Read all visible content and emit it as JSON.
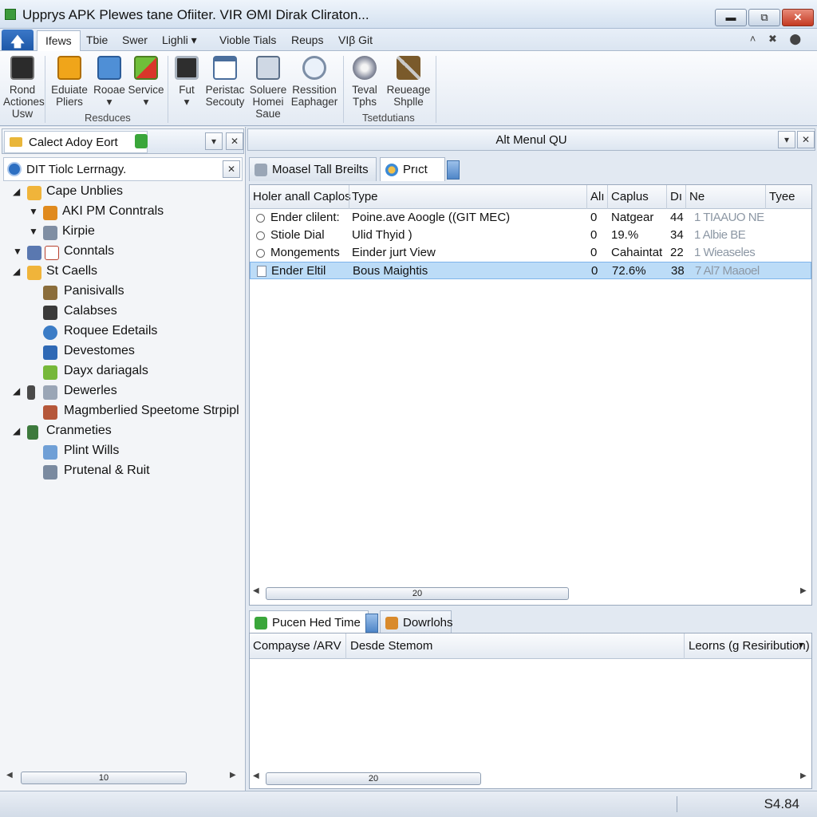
{
  "window": {
    "title": "Upprys APK Plewes tane Ofiiter. VIR ΘMI Dirak Cliraton...",
    "minimize_glyph": "▬",
    "restore_glyph": "⧉",
    "close_glyph": "✕"
  },
  "ribbon_tabs": {
    "file_glyph": "🡅",
    "items": [
      "Ifews",
      "Tbie",
      "Swer",
      "Lighli ▾",
      "Vioble Tials",
      "Reups",
      "VIβ Git"
    ],
    "right_glyphs": "˄ ✖ ⬤"
  },
  "ribbon": {
    "buttons": [
      {
        "line1": "Rond",
        "line2": "Actiones",
        "line3": "Usw",
        "icon": "record-icon"
      },
      {
        "line1": "Eduiate",
        "line2": "Pliers",
        "icon": "orange-gear-icon"
      },
      {
        "line1": "Rooae",
        "line2": "▾",
        "icon": "blue-box-icon"
      },
      {
        "line1": "Service",
        "line2": "▾",
        "icon": "green-flag-icon"
      },
      {
        "line1": "Fut",
        "line2": "▾",
        "icon": "monitor-icon"
      },
      {
        "line1": "Peristac",
        "line2": "Secouty",
        "icon": "window-icon"
      },
      {
        "line1": "Soluere",
        "line2": "Homei",
        "line3": "Saue",
        "icon": "network-icon"
      },
      {
        "line1": "Ressition",
        "line2": "Eaphager",
        "icon": "magnifier-icon"
      },
      {
        "line1": "Teval",
        "line2": "Tphs",
        "icon": "disc-icon"
      },
      {
        "line1": "Reueage",
        "line2": "Shplle",
        "icon": "tools-icon"
      }
    ],
    "groups": [
      "Resduces",
      "Tsetdutians"
    ]
  },
  "left_panel": {
    "tab_label": "Calect Adoy Eort",
    "menu_glyph": "▾",
    "close_glyph": "✕",
    "sub_label": "DIT Tiolc Lerrnagy.",
    "tree": [
      {
        "label": "Cape Unblies",
        "expander": "◢",
        "level": 0
      },
      {
        "label": "AKI PM Conntrals",
        "expander": "▼",
        "level": 1
      },
      {
        "label": "Kirpie",
        "expander": "▼",
        "level": 1
      },
      {
        "label": "Conntals",
        "expander": "▼",
        "level": 0
      },
      {
        "label": "St Caells",
        "expander": "◢",
        "level": 0
      },
      {
        "label": "Panisivalls",
        "expander": "",
        "level": 2
      },
      {
        "label": "Calabses",
        "expander": "",
        "level": 2
      },
      {
        "label": "Roquee Edetails",
        "expander": "",
        "level": 2
      },
      {
        "label": "Devestomes",
        "expander": "",
        "level": 2
      },
      {
        "label": "Dayx dariagals",
        "expander": "",
        "level": 2
      },
      {
        "label": "Dewerles",
        "expander": "◢",
        "level": 0
      },
      {
        "label": "Magmberlied Speetome Strpipl",
        "expander": "",
        "level": 2
      },
      {
        "label": "Cranmeties",
        "expander": "◢",
        "level": 0
      },
      {
        "label": "Plint Wills",
        "expander": "",
        "level": 2
      },
      {
        "label": "Prutenal & Ruit",
        "expander": "",
        "level": 2
      }
    ],
    "scroll_value": "10"
  },
  "right_panel": {
    "header": "Alt Menul QU",
    "tabs": [
      "Moasel Tall Breilts",
      "Prıct"
    ],
    "columns": [
      "Holer anall Caplos",
      "Type",
      "Alı",
      "Caplus",
      "Dı",
      "Ne",
      "Tyee"
    ],
    "rows": [
      {
        "name": "Ender clilent:",
        "type": "Poine.ave Aoogle ((GIT MEC)",
        "a": "0",
        "caplus": "Natgear",
        "d": "44",
        "ne": "1 TIAAUO NE",
        "selected": false
      },
      {
        "name": "Stiole Dial",
        "type": "Ulid Thyid )",
        "a": "0",
        "caplus": "19.%",
        "d": "34",
        "ne": "1 Albie BE",
        "selected": false
      },
      {
        "name": "Mongements",
        "type": "Einder jurt View",
        "a": "0",
        "caplus": "Cahaintat",
        "d": "22",
        "ne": "1 Wieaseles",
        "selected": false
      },
      {
        "name": "Ender Eltil",
        "type": "Bous Maightis",
        "a": "0",
        "caplus": "72.6%",
        "d": "38",
        "ne": "7 Al7 Maaoel",
        "selected": true
      }
    ],
    "grid_scroll_value": "20",
    "bottom_tabs": [
      "Pucen Hed Time",
      "Dowrlohs"
    ],
    "bottom_columns": [
      "Compayse /ARV",
      "Desde Stemom",
      "Leorns (ɡ Resiribution)"
    ],
    "bottom_scroll_value": "20"
  },
  "status": {
    "value": "S4.84"
  }
}
